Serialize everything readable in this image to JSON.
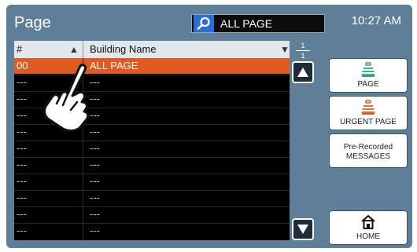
{
  "header": {
    "title": "Page",
    "search_value": "ALL PAGE",
    "time": "10:27 AM"
  },
  "table": {
    "col_num": "#",
    "col_name": "Building Name",
    "rows": [
      {
        "num": "00",
        "name": "ALL PAGE",
        "selected": true
      },
      {
        "num": "---",
        "name": "---"
      },
      {
        "num": "---",
        "name": "---"
      },
      {
        "num": "---",
        "name": "---"
      },
      {
        "num": "---",
        "name": "---"
      },
      {
        "num": "---",
        "name": "---"
      },
      {
        "num": "---",
        "name": "---"
      },
      {
        "num": "---",
        "name": "---"
      },
      {
        "num": "---",
        "name": "---"
      },
      {
        "num": "---",
        "name": "---"
      },
      {
        "num": "---",
        "name": "---"
      }
    ]
  },
  "pager": {
    "current": "1",
    "total": "1"
  },
  "side_buttons": {
    "page": "PAGE",
    "urgent": "URGENT PAGE",
    "messages_line1": "Pre-Recorded",
    "messages_line2": "MESSAGES",
    "home": "HOME"
  },
  "colors": {
    "selected_row": "#e05a23",
    "page_icon": "#2aa47a",
    "urgent_icon": "#e05a23",
    "search_icon_bg": "#2a6fd6",
    "screen_bg": "#5f7f99"
  }
}
